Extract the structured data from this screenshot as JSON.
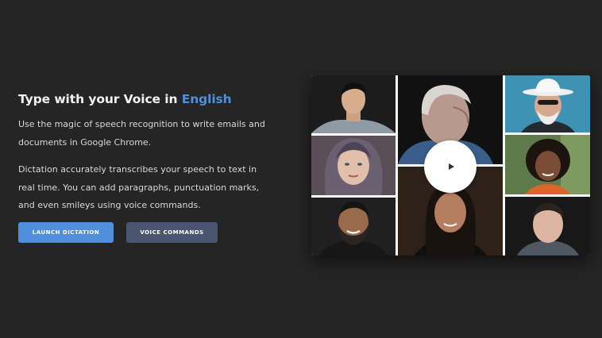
{
  "hero": {
    "title_prefix": "Type with your Voice in",
    "title_language": "English",
    "paragraph1": "Use the magic of speech recognition to write emails and documents in Google Chrome.",
    "paragraph2": "Dictation accurately transcribes your speech to text in real time. You can add paragraphs, punctuation marks, and even smileys using voice commands."
  },
  "buttons": {
    "launch_label": "LAUNCH DICTATION",
    "commands_label": "VOICE COMMANDS"
  },
  "video": {
    "play_icon": "play-icon",
    "tiles": [
      "young-man-portrait",
      "woman-headscarf-portrait",
      "bearded-man-smiling-portrait",
      "elderly-man-portrait",
      "woman-dark-hair-portrait",
      "man-white-hat-portrait",
      "woman-curly-hair-portrait",
      "man-short-hair-portrait"
    ]
  },
  "colors": {
    "background": "#252525",
    "accent": "#4f8fdc",
    "secondary_button": "#4a5570",
    "text": "#e6e6e6"
  }
}
